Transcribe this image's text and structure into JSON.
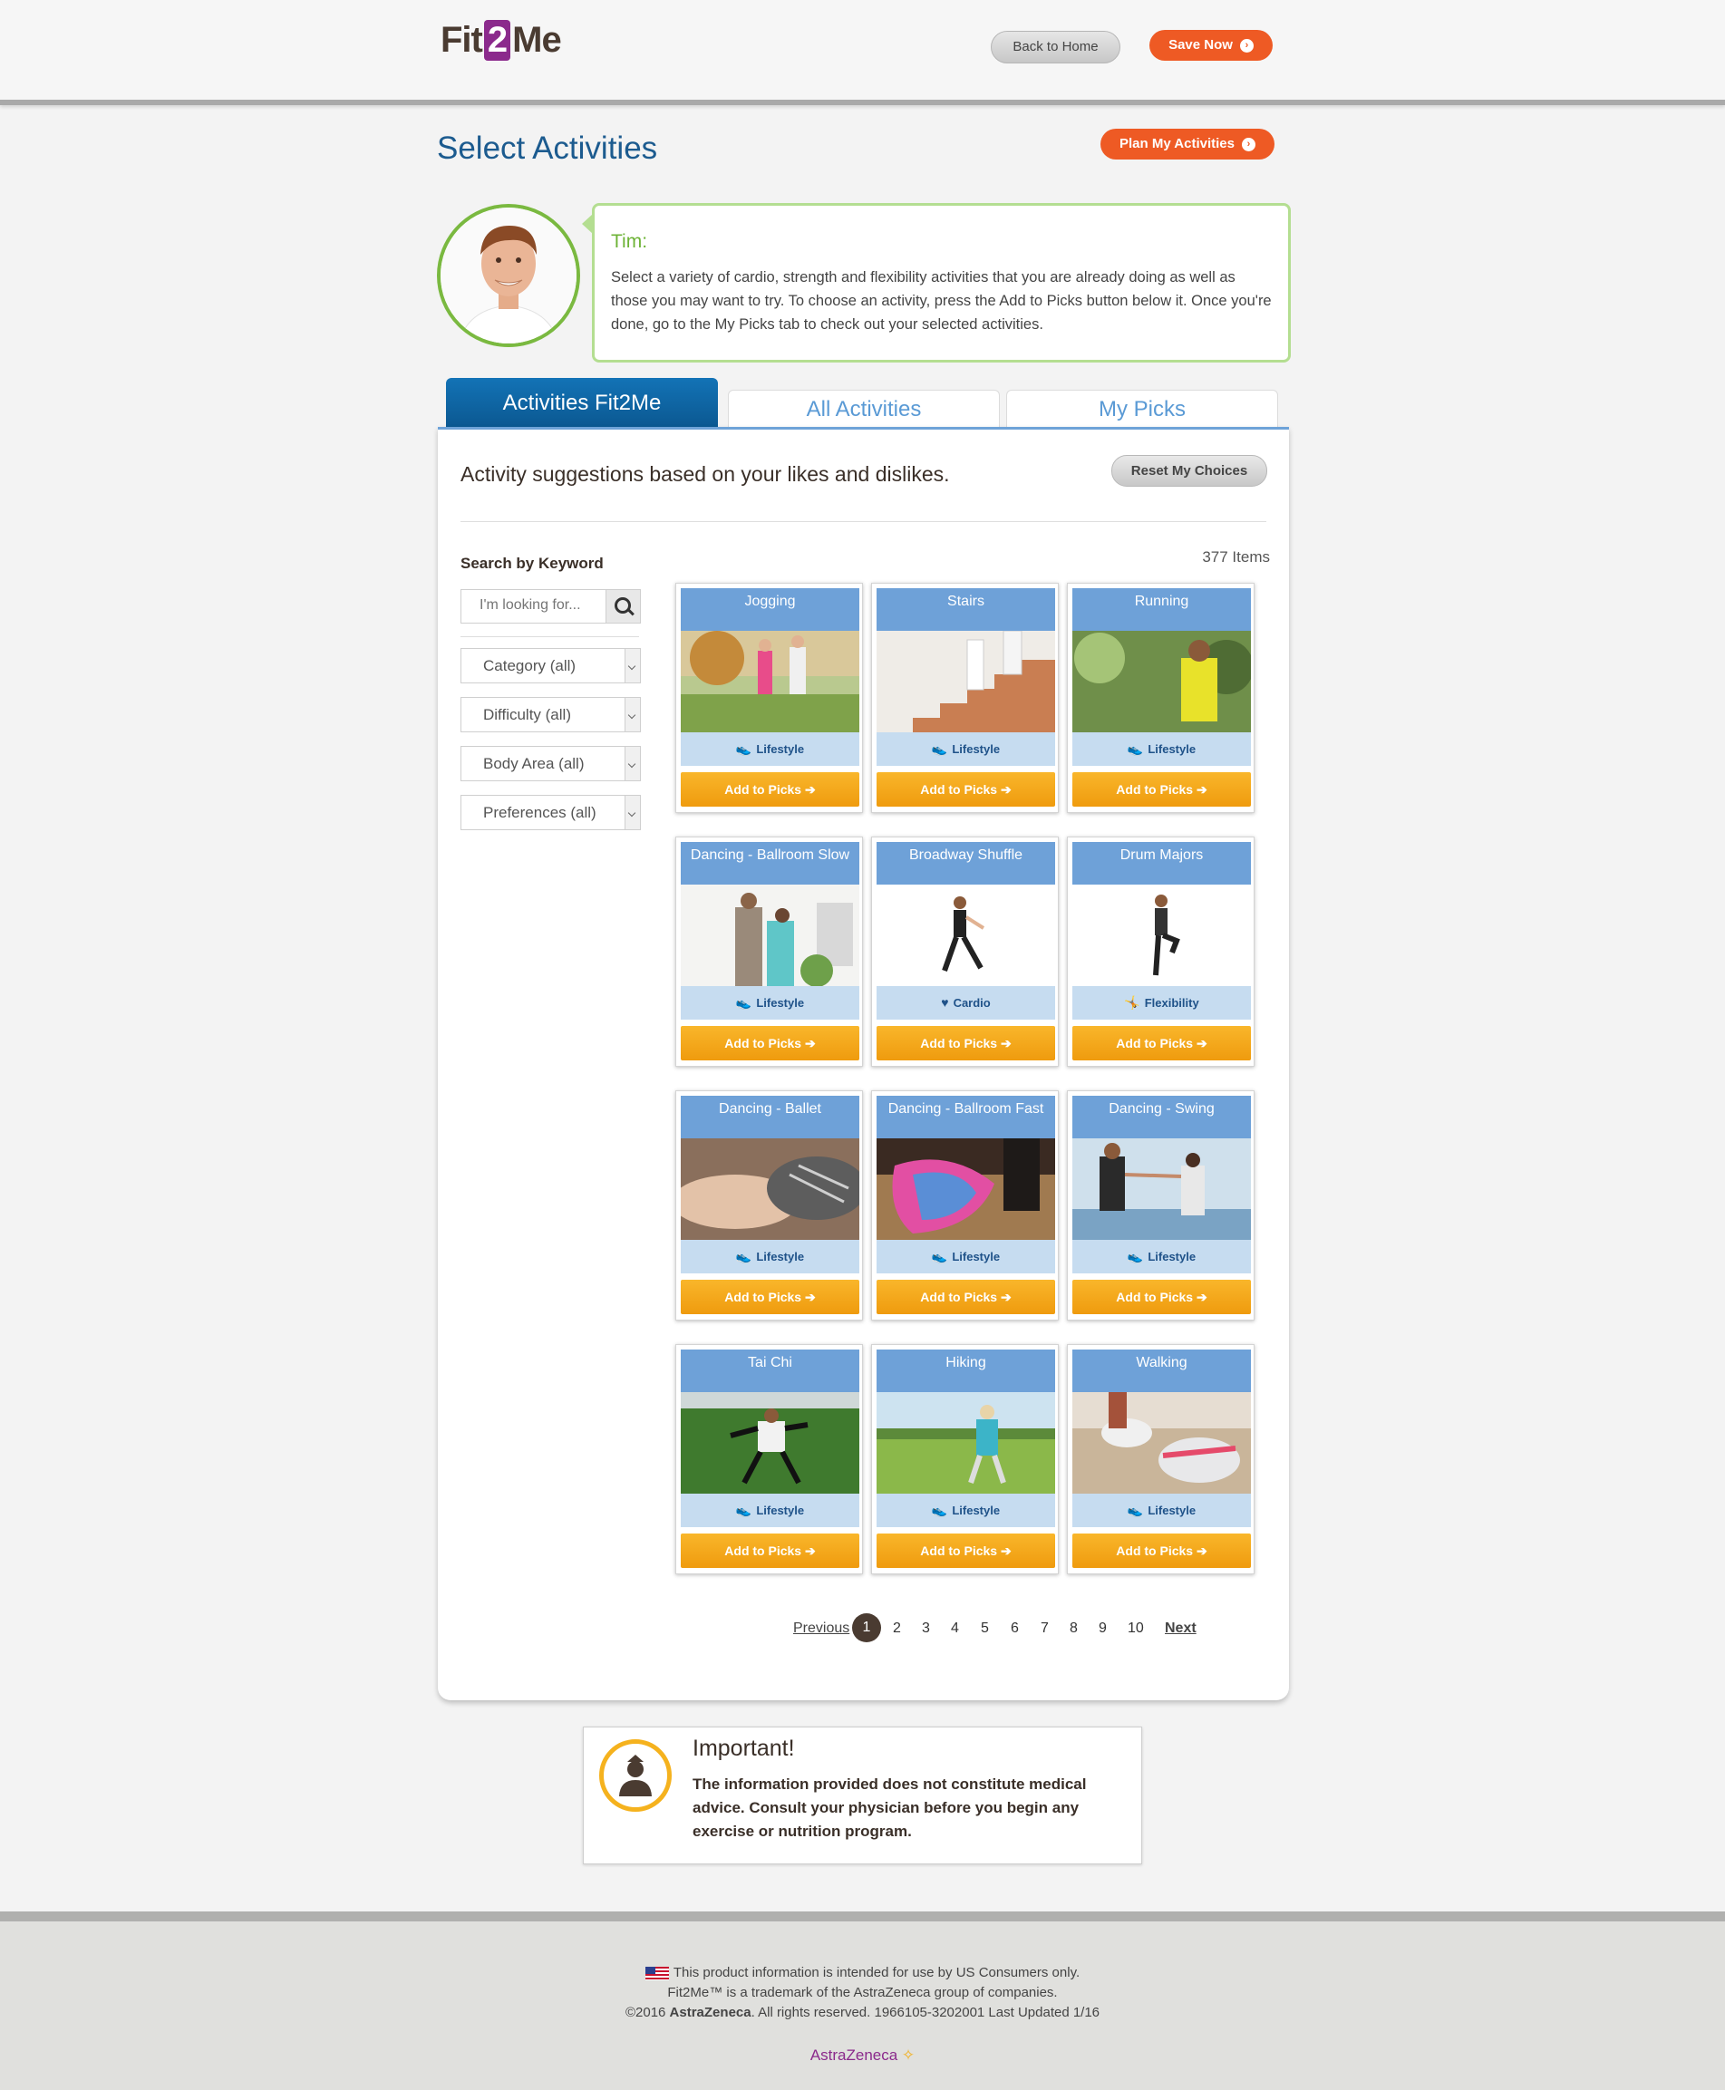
{
  "header": {
    "logo_prefix": "Fit",
    "logo_two": "2",
    "logo_suffix": "Me",
    "back_home": "Back to Home",
    "save_now": "Save Now"
  },
  "page": {
    "title": "Select Activities",
    "plan_button": "Plan My Activities"
  },
  "coach": {
    "name": "Tim:",
    "message": "Select a variety of cardio, strength and flexibility activities that you are already doing as well as those you may want to try. To choose an activity, press the Add to Picks button below it. Once you're done, go to the My Picks tab to check out your selected activities."
  },
  "tabs": {
    "active": "Activities Fit2Me",
    "all": "All Activities",
    "picks": "My Picks"
  },
  "panel": {
    "subtitle": "Activity suggestions based on your likes and dislikes.",
    "reset": "Reset My Choices",
    "items_count": "377 Items",
    "search_label": "Search by Keyword",
    "search_placeholder": "I'm looking for...",
    "filters": [
      "Category (all)",
      "Difficulty (all)",
      "Body Area (all)",
      "Preferences (all)"
    ]
  },
  "activities": [
    {
      "title": "Jogging",
      "category": "Lifestyle",
      "button": "Add to Picks"
    },
    {
      "title": "Stairs",
      "category": "Lifestyle",
      "button": "Add to Picks"
    },
    {
      "title": "Running",
      "category": "Lifestyle",
      "button": "Add to Picks"
    },
    {
      "title": "Dancing - Ballroom Slow",
      "category": "Lifestyle",
      "button": "Add to Picks"
    },
    {
      "title": "Broadway Shuffle",
      "category": "Cardio",
      "button": "Add to Picks"
    },
    {
      "title": "Drum Majors",
      "category": "Flexibility",
      "button": "Add to Picks"
    },
    {
      "title": "Dancing - Ballet",
      "category": "Lifestyle",
      "button": "Add to Picks"
    },
    {
      "title": "Dancing - Ballroom Fast",
      "category": "Lifestyle",
      "button": "Add to Picks"
    },
    {
      "title": "Dancing - Swing",
      "category": "Lifestyle",
      "button": "Add to Picks"
    },
    {
      "title": "Tai Chi",
      "category": "Lifestyle",
      "button": "Add to Picks"
    },
    {
      "title": "Hiking",
      "category": "Lifestyle",
      "button": "Add to Picks"
    },
    {
      "title": "Walking",
      "category": "Lifestyle",
      "button": "Add to Picks"
    }
  ],
  "pagination": {
    "previous": "Previous",
    "pages": [
      "1",
      "2",
      "3",
      "4",
      "5",
      "6",
      "7",
      "8",
      "9",
      "10"
    ],
    "current": "1",
    "next": "Next"
  },
  "important": {
    "title": "Important!",
    "text": "The information provided does not constitute medical advice. Consult your physician before you begin any exercise or nutrition program."
  },
  "footer": {
    "line1": "This product information is intended for use by US Consumers only.",
    "line2": "Fit2Me™ is a trademark of the AstraZeneca group of companies.",
    "line3_prefix": "©2016 ",
    "line3_brand": "AstraZeneca",
    "line3_suffix": ". All rights reserved. 1966105-3202001 Last Updated 1/16",
    "logo": "AstraZeneca"
  },
  "colors": {
    "accent_orange": "#ee5a24",
    "brand_blue": "#0b5891",
    "card_title": "#6ea1d8",
    "add_button": "#f5a91d",
    "coach_green": "#7ab940"
  }
}
